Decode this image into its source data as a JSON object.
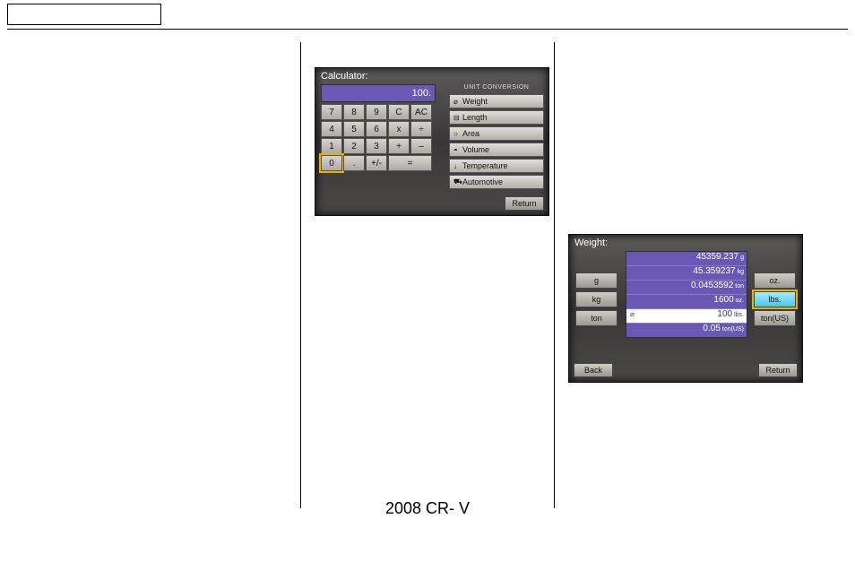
{
  "footer": "2008  CR- V",
  "calc": {
    "title": "Calculator:",
    "display": "100.",
    "keys": [
      [
        "7",
        "8",
        "9",
        "C",
        "AC"
      ],
      [
        "4",
        "5",
        "6",
        "x",
        "÷"
      ],
      [
        "1",
        "2",
        "3",
        "+",
        "–"
      ],
      [
        "0",
        ".",
        "+/-",
        "=",
        ""
      ]
    ],
    "highlighted_key": "0",
    "conversion_title": "UNIT CONVERSION",
    "conversions": [
      {
        "icon": "⌀",
        "label": "Weight"
      },
      {
        "icon": "⊟",
        "label": "Length"
      },
      {
        "icon": "○",
        "label": "Area"
      },
      {
        "icon": "◓",
        "label": "Volume"
      },
      {
        "icon": "↓",
        "label": "Temperature"
      },
      {
        "icon": "⛟",
        "label": "Automotive"
      }
    ],
    "return": "Return"
  },
  "weight": {
    "title": "Weight:",
    "rows": [
      {
        "value": "45359.237",
        "unit": "g",
        "hl": false
      },
      {
        "value": "45.359237",
        "unit": "kg",
        "hl": false
      },
      {
        "value": "0.0453592",
        "unit": "ton",
        "hl": false
      },
      {
        "value": "1600",
        "unit": "oz.",
        "hl": false
      },
      {
        "value": "100",
        "unit": "lbs.",
        "hl": true,
        "icon": "⌀"
      },
      {
        "value": "0.05",
        "unit": "ton(US)",
        "hl": false
      }
    ],
    "left_units": [
      "g",
      "kg",
      "ton"
    ],
    "right_units": [
      {
        "label": "oz.",
        "sel": false
      },
      {
        "label": "lbs.",
        "sel": true
      },
      {
        "label": "ton(US)",
        "sel": false
      }
    ],
    "back": "Back",
    "return": "Return"
  }
}
